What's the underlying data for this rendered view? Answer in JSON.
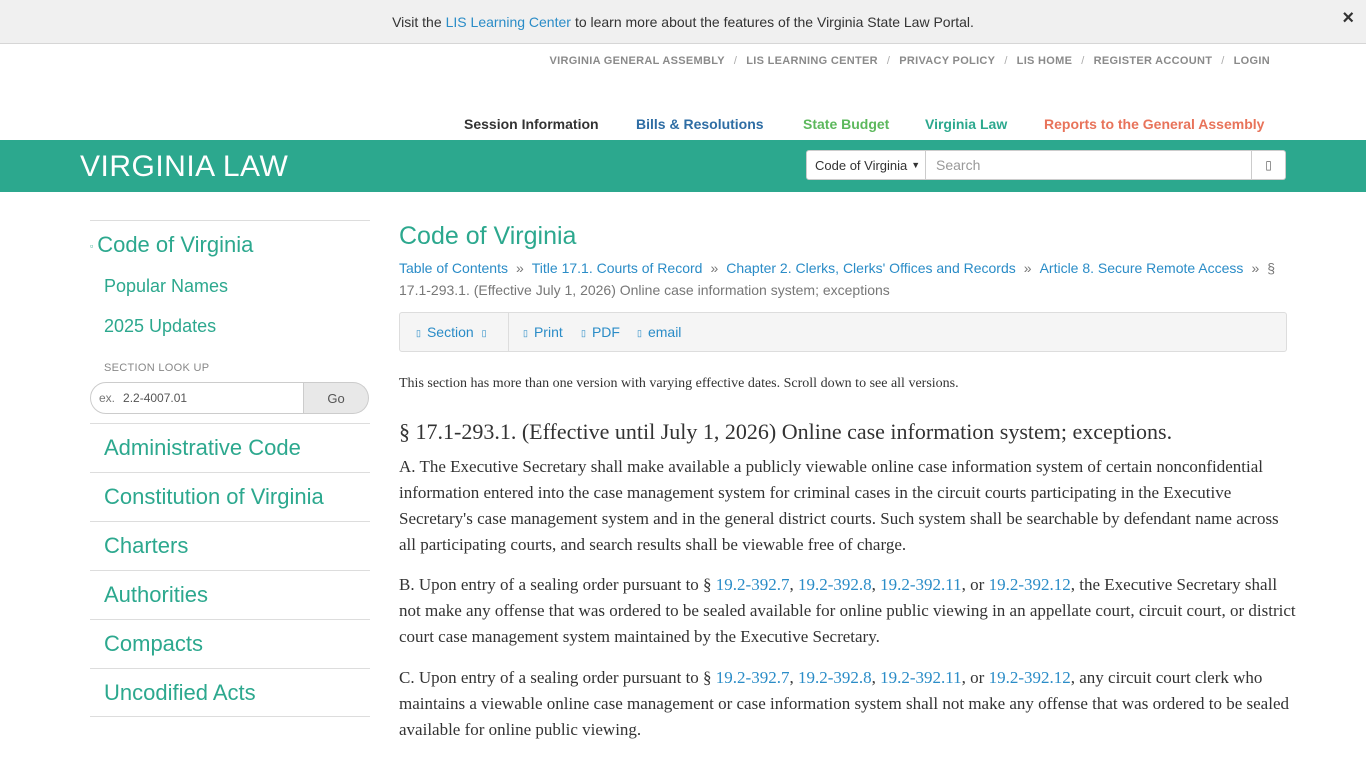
{
  "notice": {
    "prefix": "Visit the",
    "link": "LIS Learning Center",
    "suffix": "to learn more about the features of the Virginia State Law Portal.",
    "close": "×"
  },
  "util_nav": [
    "VIRGINIA GENERAL ASSEMBLY",
    "LIS LEARNING CENTER",
    "PRIVACY POLICY",
    "LIS HOME",
    "REGISTER ACCOUNT",
    "LOGIN"
  ],
  "util_sep": "/",
  "main_nav": [
    {
      "label": "Session Information",
      "color": "#333333"
    },
    {
      "label": "Bills & Resolutions",
      "color": "#2e6da4"
    },
    {
      "label": "State Budget",
      "color": "#5cb85c"
    },
    {
      "label": "Virginia Law",
      "color": "#2ca88e"
    },
    {
      "label": "Reports to the General Assembly",
      "color": "#e8735a"
    }
  ],
  "header": {
    "brand": "VIRGINIA LAW",
    "scope": "Code of Virginia",
    "search_placeholder": "Search"
  },
  "sidebar": {
    "main": "Code of Virginia",
    "subs": [
      "Popular Names",
      "2025 Updates"
    ],
    "lookup_label": "SECTION LOOK UP",
    "lookup_prefix": "ex.",
    "lookup_value": "2.2-4007.01",
    "go": "Go",
    "sections": [
      "Administrative Code",
      "Constitution of Virginia",
      "Charters",
      "Authorities",
      "Compacts",
      "Uncodified Acts"
    ]
  },
  "content": {
    "title": "Code of Virginia",
    "breadcrumbs": [
      "Table of Contents",
      "Title 17.1. Courts of Record",
      "Chapter 2. Clerks, Clerks' Offices and Records",
      "Article 8. Secure Remote Access"
    ],
    "crumb_sep": "»",
    "crumb_tail_a": "§",
    "crumb_tail_b": "17.1-293.1. (Effective July 1, 2026) Online case information system; exceptions",
    "toolbar": {
      "section": "Section",
      "print": "Print",
      "pdf": "PDF",
      "email": "email"
    },
    "note": "This section has more than one version with varying effective dates. Scroll down to see all versions.",
    "heading": "§ 17.1-293.1. (Effective until July 1, 2026) Online case information system; exceptions.",
    "para_a": "A. The Executive Secretary shall make available a publicly viewable online case information system of certain nonconfidential information entered into the case management system for criminal cases in the circuit courts participating in the Executive Secretary's case management system and in the general district courts. Such system shall be searchable by defendant name across all participating courts, and search results shall be viewable free of charge.",
    "para_b": {
      "prefix": "B. Upon entry of a sealing order pursuant to §",
      "refs": [
        "19.2-392.7",
        "19.2-392.8",
        "19.2-392.11",
        "19.2-392.12"
      ],
      "suffix": ", the Executive Secretary shall not make any offense that was ordered to be sealed available for online public viewing in an appellate court, circuit court, or district court case management system maintained by the Executive Secretary."
    },
    "para_c": {
      "prefix": "C. Upon entry of a sealing order pursuant to §",
      "refs": [
        "19.2-392.7",
        "19.2-392.8",
        "19.2-392.11",
        "19.2-392.12"
      ],
      "suffix": ", any circuit court clerk who maintains a viewable online case management or case information system shall not make any offense that was ordered to be sealed available for online public viewing."
    }
  }
}
